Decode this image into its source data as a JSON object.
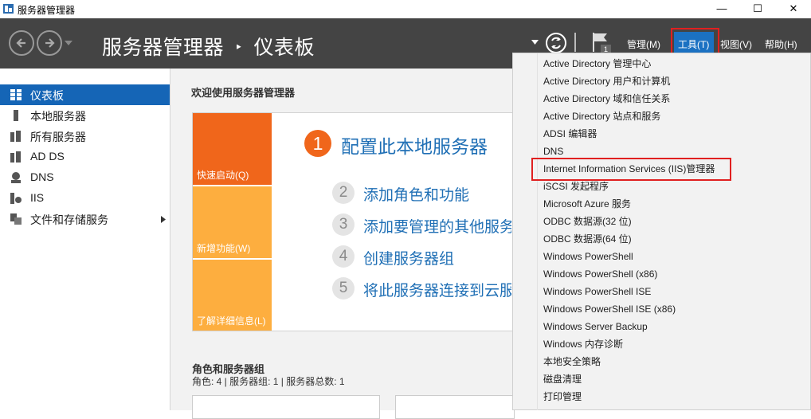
{
  "window": {
    "title": "服务器管理器",
    "minimize": "—",
    "maximize": "☐",
    "close": "✕"
  },
  "header": {
    "breadcrumb_root": "服务器管理器",
    "breadcrumb_sep": "‣",
    "breadcrumb_page": "仪表板",
    "notification_count": "1",
    "menu": {
      "manage": "管理(M)",
      "tools": "工具(T)",
      "view": "视图(V)",
      "help": "帮助(H)"
    }
  },
  "sidebar": {
    "items": [
      {
        "label": "仪表板",
        "icon": "dashboard-icon"
      },
      {
        "label": "本地服务器",
        "icon": "server-icon"
      },
      {
        "label": "所有服务器",
        "icon": "servers-icon"
      },
      {
        "label": "AD DS",
        "icon": "ad-ds-icon"
      },
      {
        "label": "DNS",
        "icon": "dns-icon"
      },
      {
        "label": "IIS",
        "icon": "iis-icon"
      },
      {
        "label": "文件和存储服务",
        "icon": "file-storage-icon"
      }
    ]
  },
  "main": {
    "welcome": "欢迎使用服务器管理器",
    "tiles": {
      "quickstart": "快速启动(Q)",
      "whatsnew": "新增功能(W)",
      "learnmore": "了解详细信息(L)"
    },
    "steps": [
      {
        "num": "1",
        "label": "配置此本地服务器"
      },
      {
        "num": "2",
        "label": "添加角色和功能"
      },
      {
        "num": "3",
        "label": "添加要管理的其他服务器"
      },
      {
        "num": "4",
        "label": "创建服务器组"
      },
      {
        "num": "5",
        "label": "将此服务器连接到云服务"
      }
    ],
    "roles_title": "角色和服务器组",
    "roles_count": "角色: 4 | 服务器组: 1 | 服务器总数: 1"
  },
  "tools_menu": [
    "Active Directory 管理中心",
    "Active Directory 用户和计算机",
    "Active Directory 域和信任关系",
    "Active Directory 站点和服务",
    "ADSI 编辑器",
    "DNS",
    "Internet Information Services (IIS)管理器",
    "iSCSI 发起程序",
    "Microsoft Azure 服务",
    "ODBC 数据源(32 位)",
    "ODBC 数据源(64 位)",
    "Windows PowerShell",
    "Windows PowerShell (x86)",
    "Windows PowerShell ISE",
    "Windows PowerShell ISE (x86)",
    "Windows Server Backup",
    "Windows 内存诊断",
    "本地安全策略",
    "磁盘清理",
    "打印管理"
  ],
  "colors": {
    "header_bg": "#444444",
    "sidebar_active": "#1565b6",
    "tile_orange": "#f0661b",
    "tile_amber": "#fdae3f",
    "link_blue": "#1f6fb5",
    "highlight_red": "#e02020"
  }
}
